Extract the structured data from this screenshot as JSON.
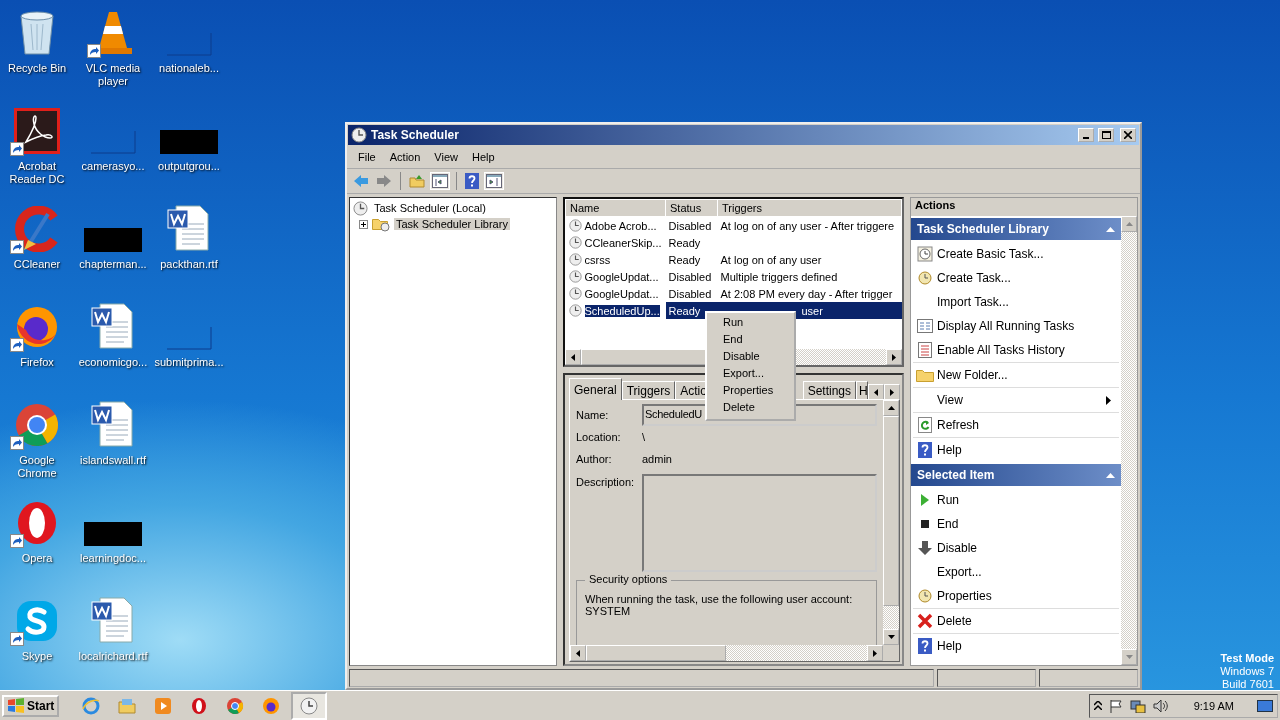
{
  "desktop": {
    "icons": [
      {
        "label": "Recycle Bin",
        "kind": "recycle",
        "shortcut": false
      },
      {
        "label": "Acrobat Reader DC",
        "kind": "acrobat",
        "shortcut": true
      },
      {
        "label": "CCleaner",
        "kind": "ccleaner",
        "shortcut": true
      },
      {
        "label": "Firefox",
        "kind": "firefox",
        "shortcut": true
      },
      {
        "label": "Google Chrome",
        "kind": "chrome",
        "shortcut": true
      },
      {
        "label": "Opera",
        "kind": "opera",
        "shortcut": true
      },
      {
        "label": "Skype",
        "kind": "skype",
        "shortcut": true
      },
      {
        "label": "VLC media player",
        "kind": "vlc",
        "shortcut": true
      },
      {
        "label": "camerasyo...",
        "kind": "blank",
        "shortcut": false
      },
      {
        "label": "chapterman...",
        "kind": "black",
        "shortcut": false
      },
      {
        "label": "economicgo...",
        "kind": "word",
        "shortcut": false
      },
      {
        "label": "islandswall.rtf",
        "kind": "word",
        "shortcut": false
      },
      {
        "label": "learningdoc...",
        "kind": "black",
        "shortcut": false
      },
      {
        "label": "localrichard.rtf",
        "kind": "word",
        "shortcut": false
      },
      {
        "label": "nationaleb...",
        "kind": "blank",
        "shortcut": false
      },
      {
        "label": "outputgrou...",
        "kind": "black",
        "shortcut": false
      },
      {
        "label": "packthan.rtf",
        "kind": "word",
        "shortcut": false
      },
      {
        "label": "submitprima...",
        "kind": "blank",
        "shortcut": false
      }
    ],
    "notice": [
      "Test Mode",
      "Windows 7",
      "Build 7601"
    ]
  },
  "window": {
    "title": "Task Scheduler",
    "menu": [
      "File",
      "Action",
      "View",
      "Help"
    ],
    "tree": [
      {
        "label": "Task Scheduler (Local)",
        "kind": "clock",
        "selected": false,
        "children": [
          {
            "label": "Task Scheduler Library",
            "kind": "folder",
            "selected": true,
            "expanded": false
          }
        ]
      }
    ],
    "task_list": {
      "columns": [
        "Name",
        "Status",
        "Triggers"
      ],
      "rows": [
        {
          "name": "Adobe Acrob...",
          "status": "Disabled",
          "triggers": "At log on of any user - After triggere",
          "selected": false
        },
        {
          "name": "CCleanerSkip...",
          "status": "Ready",
          "selected": false
        },
        {
          "name": "csrss",
          "status": "Ready",
          "triggers": "At log on of any user",
          "selected": false
        },
        {
          "name": "GoogleUpdat...",
          "status": "Disabled",
          "triggers": "Multiple triggers defined",
          "selected": false
        },
        {
          "name": "GoogleUpdat...",
          "status": "Disabled",
          "triggers": "At 2:08 PM every day - After trigger",
          "selected": false
        },
        {
          "name": "ScheduledUp...",
          "status": "Ready",
          "triggers": "user",
          "selected": true
        }
      ]
    },
    "context_menu": [
      "Run",
      "End",
      "Disable",
      "Export...",
      "Properties",
      "Delete"
    ],
    "detail": {
      "tabs": [
        {
          "label": "General",
          "selected": true
        },
        {
          "label": "Triggers",
          "selected": false
        },
        {
          "label": "Actio",
          "selected": false
        },
        {
          "label": "Settings",
          "selected": false
        },
        {
          "label": "H",
          "selected": false
        }
      ],
      "fields": [
        {
          "label": "Name:",
          "value": "ScheduledU",
          "kind": "field"
        },
        {
          "label": "Location:",
          "value": "\\",
          "kind": "text"
        },
        {
          "label": "Author:",
          "value": "admin",
          "kind": "text"
        },
        {
          "label": "Description:",
          "kind": "area"
        }
      ],
      "security": {
        "title": "Security options",
        "text": "When running the task, use the following user account:",
        "account": "SYSTEM"
      }
    },
    "actions": {
      "title": "Actions",
      "sections": [
        {
          "title": "Task Scheduler Library",
          "expanded": true,
          "items": [
            {
              "label": "Create Basic Task...",
              "kind": "basic",
              "divider": false
            },
            {
              "label": "Create Task...",
              "kind": "create",
              "divider": false
            },
            {
              "label": "Import Task...",
              "kind": "plain",
              "divider": false
            },
            {
              "label": "Display All Running Tasks",
              "kind": "running",
              "divider": false
            },
            {
              "label": "Enable All Tasks History",
              "kind": "history",
              "divider": false
            },
            {
              "label": "New Folder...",
              "kind": "folder",
              "divider": true
            },
            {
              "label": "View",
              "kind": "submenu",
              "divider": true
            },
            {
              "label": "Refresh",
              "kind": "refresh",
              "divider": true
            },
            {
              "label": "Help",
              "kind": "help",
              "divider": true
            }
          ]
        },
        {
          "title": "Selected Item",
          "expanded": true,
          "items": [
            {
              "label": "Run",
              "kind": "run",
              "divider": false
            },
            {
              "label": "End",
              "kind": "end",
              "divider": false
            },
            {
              "label": "Disable",
              "kind": "disable",
              "divider": false
            },
            {
              "label": "Export...",
              "kind": "plain",
              "divider": false
            },
            {
              "label": "Properties",
              "kind": "properties",
              "divider": false
            },
            {
              "label": "Delete",
              "kind": "delete",
              "divider": true
            },
            {
              "label": "Help",
              "kind": "help",
              "divider": true
            }
          ]
        }
      ]
    }
  },
  "taskbar": {
    "start": "Start",
    "apps": [
      {
        "kind": "ie",
        "active": false
      },
      {
        "kind": "explorer",
        "active": false
      },
      {
        "kind": "media",
        "active": false
      },
      {
        "kind": "opera",
        "active": false
      },
      {
        "kind": "chrome",
        "active": false
      },
      {
        "kind": "firefox",
        "active": false
      },
      {
        "kind": "scheduler",
        "active": true
      }
    ],
    "clock": "9:19 AM"
  }
}
